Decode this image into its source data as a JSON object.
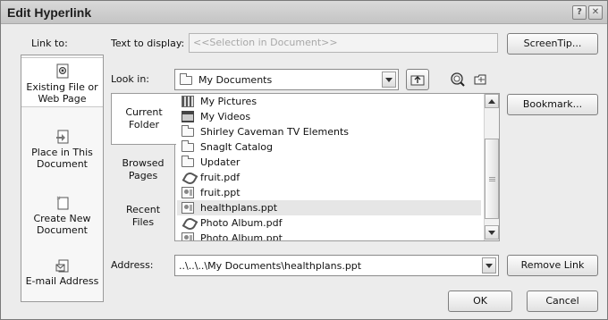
{
  "window": {
    "title": "Edit Hyperlink",
    "help_glyph": "?",
    "close_glyph": "✕"
  },
  "link_to": {
    "label": "Link to:",
    "items": [
      {
        "label_line1": "Existing File or",
        "label_line2": "Web Page",
        "icon": "globe-file-icon"
      },
      {
        "label_line1": "Place in This",
        "label_line2": "Document",
        "icon": "document-place-icon"
      },
      {
        "label_line1": "Create New",
        "label_line2": "Document",
        "icon": "new-document-icon"
      },
      {
        "label_line1": "E-mail Address",
        "label_line2": "",
        "icon": "email-icon"
      }
    ]
  },
  "text_to_display": {
    "label": "Text to display:",
    "value": "<<Selection in Document>>"
  },
  "screentip_button": "ScreenTip...",
  "look_in": {
    "label": "Look in:",
    "value": "My Documents"
  },
  "toolbar_icons": [
    "up-folder-icon",
    "browse-web-icon",
    "browse-file-icon"
  ],
  "side_tabs": [
    {
      "line1": "Current",
      "line2": "Folder"
    },
    {
      "line1": "Browsed",
      "line2": "Pages"
    },
    {
      "line1": "Recent",
      "line2": "Files"
    }
  ],
  "files": [
    {
      "name": "My Pictures",
      "type": "pictures-folder-icon"
    },
    {
      "name": "My Videos",
      "type": "videos-folder-icon"
    },
    {
      "name": "Shirley Caveman TV Elements",
      "type": "folder-icon"
    },
    {
      "name": "SnagIt Catalog",
      "type": "folder-icon"
    },
    {
      "name": "Updater",
      "type": "folder-icon"
    },
    {
      "name": "fruit.pdf",
      "type": "pdf-icon"
    },
    {
      "name": "fruit.ppt",
      "type": "ppt-icon"
    },
    {
      "name": "healthplans.ppt",
      "type": "ppt-icon",
      "selected": true
    },
    {
      "name": "Photo Album.pdf",
      "type": "pdf-icon"
    },
    {
      "name": "Photo Album.ppt",
      "type": "ppt-icon"
    }
  ],
  "bookmark_button": "Bookmark...",
  "address": {
    "label": "Address:",
    "value": "..\\..\\..\\My Documents\\healthplans.ppt"
  },
  "remove_link_button": "Remove Link",
  "ok_button": "OK",
  "cancel_button": "Cancel"
}
